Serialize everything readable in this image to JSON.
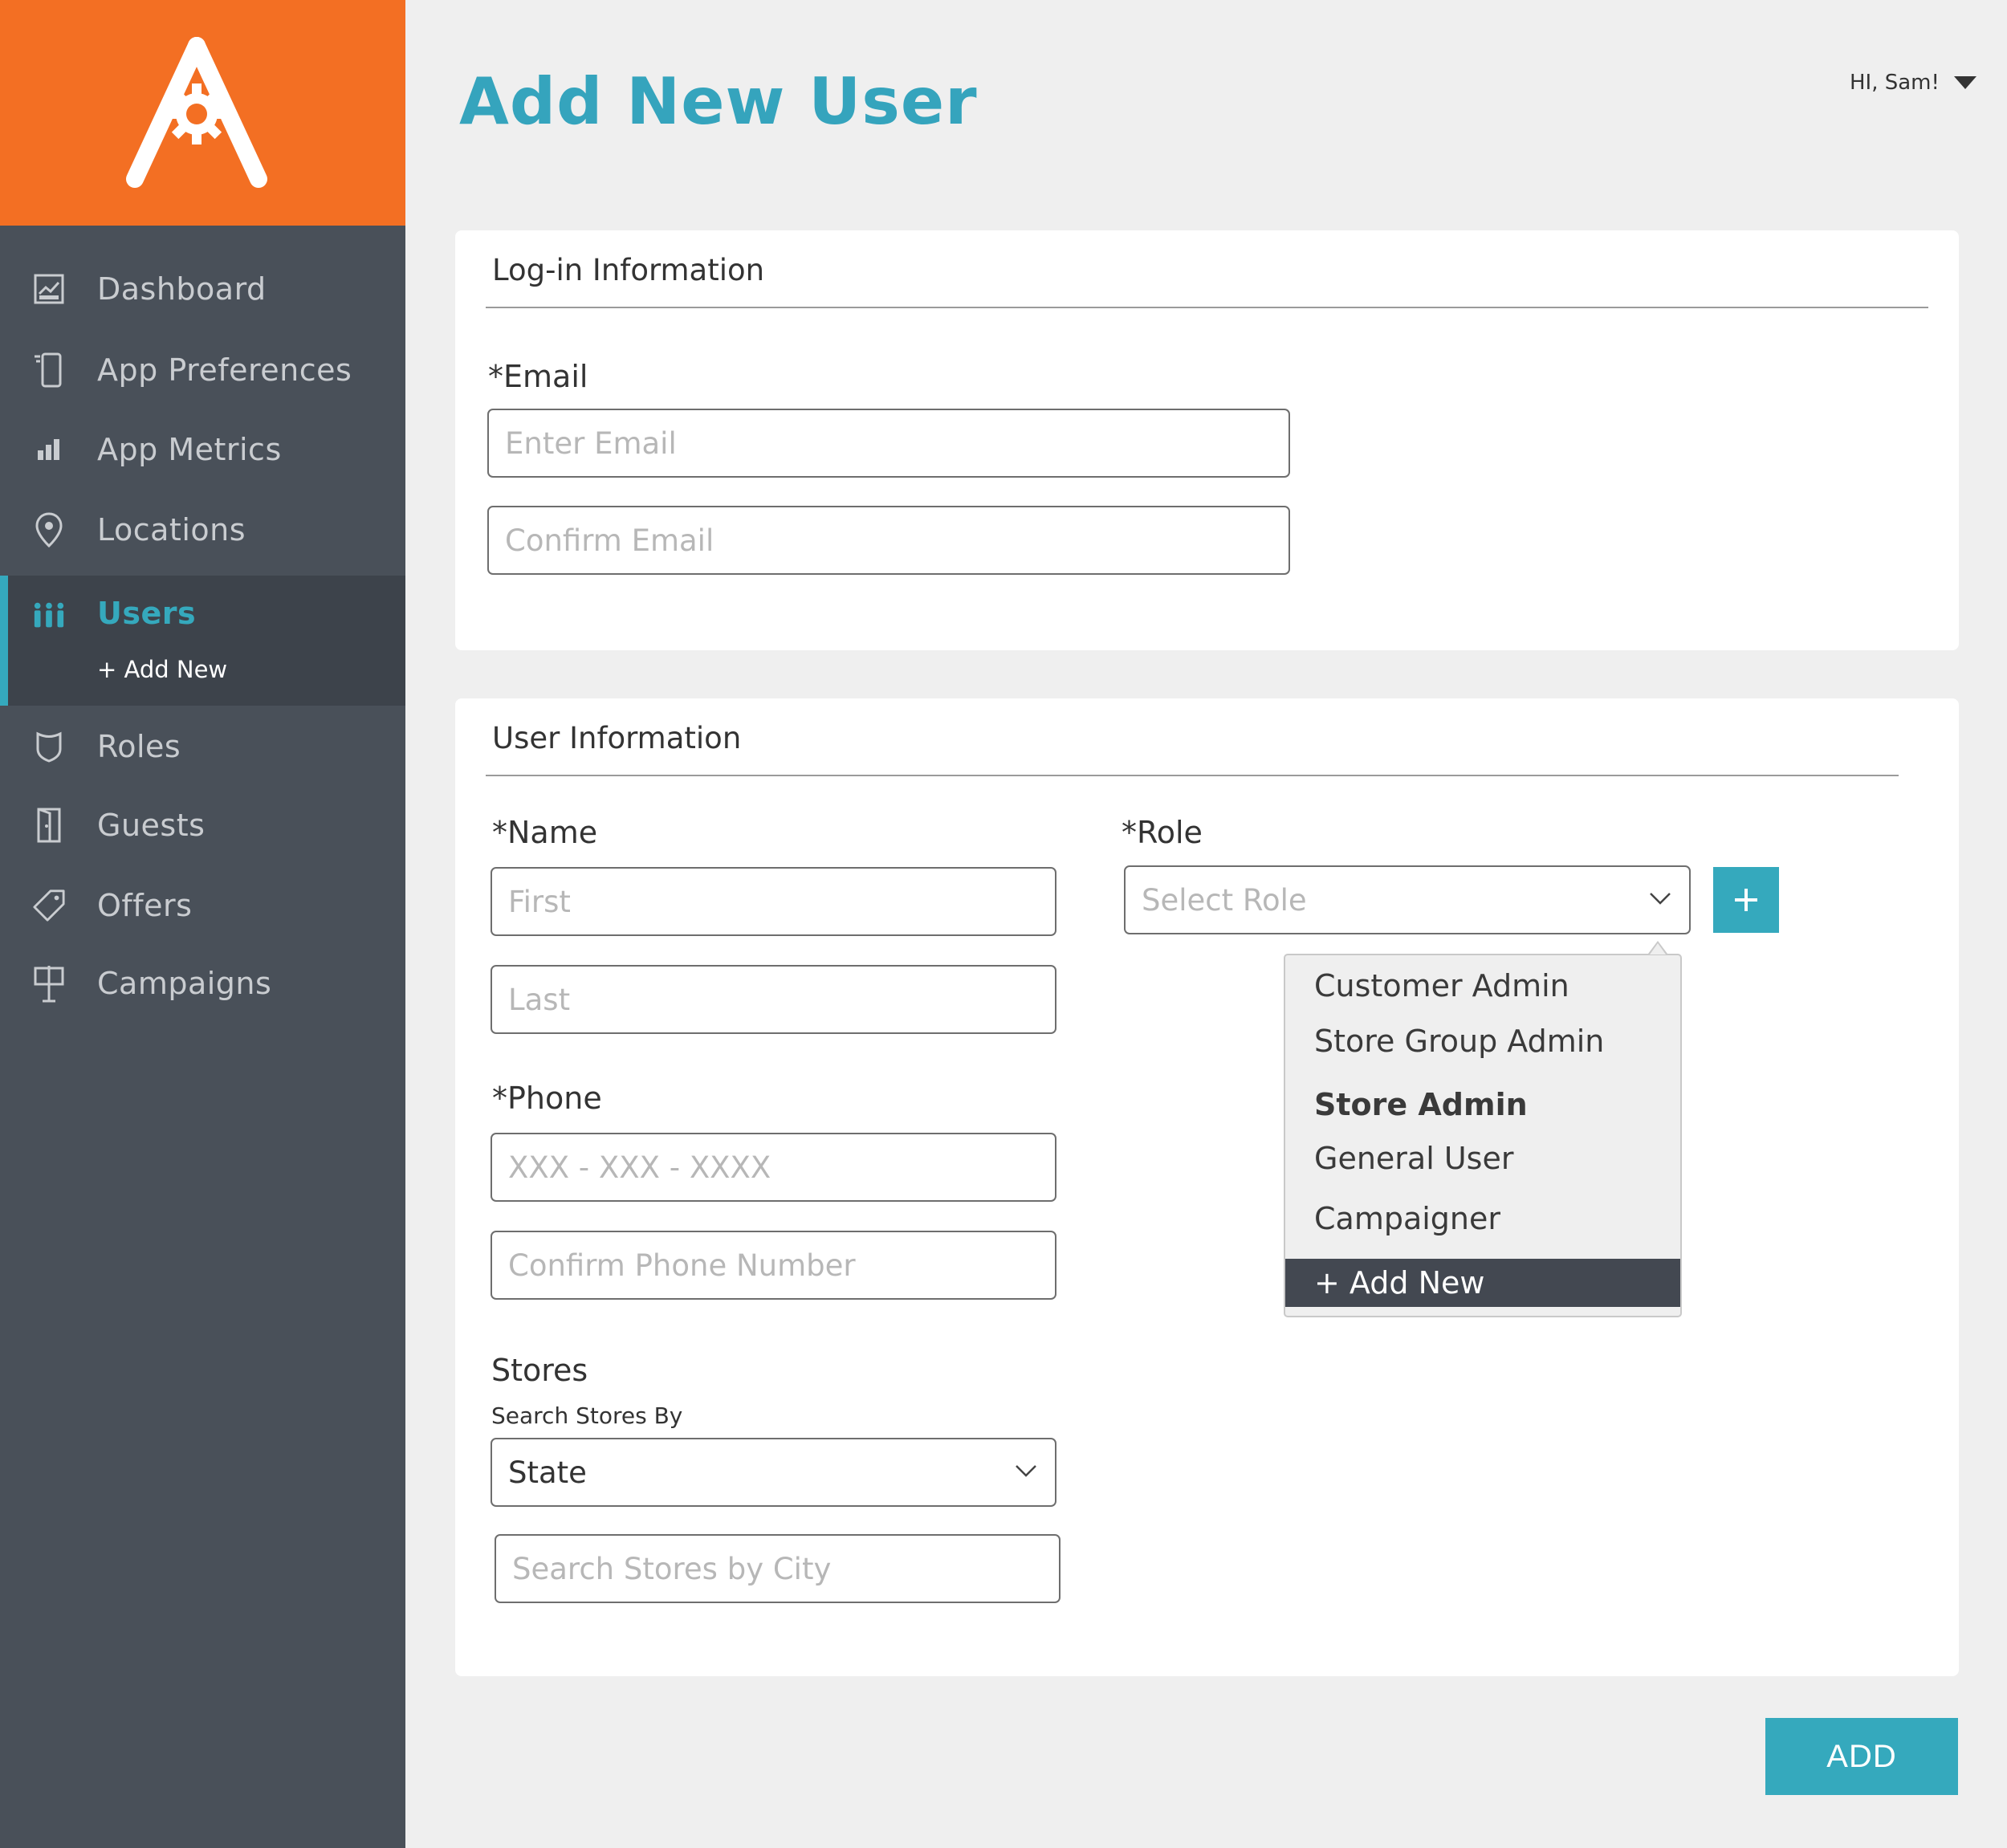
{
  "page": {
    "title": "Add New User"
  },
  "user_menu": {
    "greeting": "HI, Sam!"
  },
  "sidebar": {
    "items": [
      {
        "label": "Dashboard",
        "icon": "dashboard-icon"
      },
      {
        "label": "App Preferences",
        "icon": "phone-icon"
      },
      {
        "label": "App Metrics",
        "icon": "bar-chart-icon"
      },
      {
        "label": "Locations",
        "icon": "map-pin-icon"
      },
      {
        "label": "Users",
        "icon": "users-icon",
        "active": true,
        "sub_label": "+ Add New"
      },
      {
        "label": "Roles",
        "icon": "badge-icon"
      },
      {
        "label": "Guests",
        "icon": "door-icon"
      },
      {
        "label": "Offers",
        "icon": "tag-icon"
      },
      {
        "label": "Campaigns",
        "icon": "signboard-icon"
      }
    ]
  },
  "login_card": {
    "title": "Log-in Information",
    "email_label": "*Email",
    "email_placeholder": "Enter Email",
    "confirm_email_placeholder": "Confirm Email"
  },
  "user_card": {
    "title": "User Information",
    "name_label": "*Name",
    "first_placeholder": "First",
    "last_placeholder": "Last",
    "phone_label": "*Phone",
    "phone_placeholder": "XXX - XXX - XXXX",
    "confirm_phone_placeholder": "Confirm Phone Number",
    "role_label": "*Role",
    "role_placeholder": "Select Role",
    "role_add_label": "+",
    "role_options": [
      "Customer Admin",
      "Store Group Admin",
      "Store Admin",
      "General User",
      "Campaigner"
    ],
    "role_add_new": "+ Add New",
    "stores_label": "Stores",
    "stores_search_by_label": "Search Stores By",
    "stores_search_by_value": "State",
    "stores_city_placeholder": "Search Stores by City"
  },
  "actions": {
    "add_label": "ADD"
  },
  "colors": {
    "brand_orange": "#f36f23",
    "accent_teal": "#35a9bd",
    "sidebar_bg": "#495059"
  }
}
